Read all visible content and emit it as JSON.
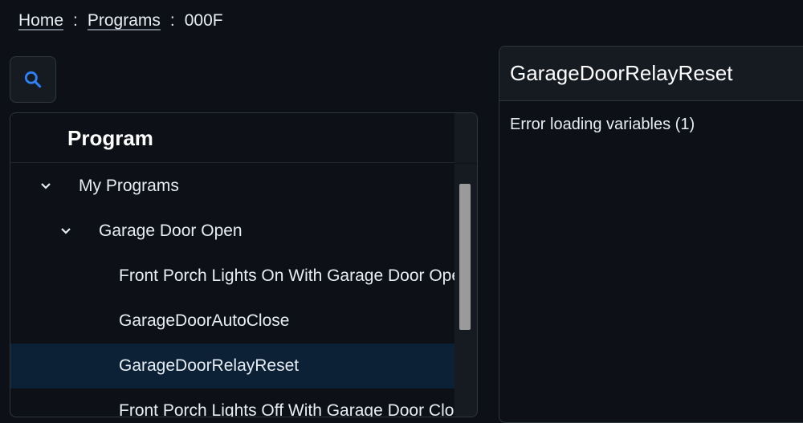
{
  "breadcrumb": {
    "home": "Home",
    "separator": ":",
    "programs": "Programs",
    "current": "000F"
  },
  "search": {
    "icon": "search-icon",
    "color": "#2f81f7"
  },
  "tree": {
    "header_title": "Program",
    "rows": [
      {
        "label": "My Programs",
        "expanded": true,
        "level": 0
      },
      {
        "label": "Garage Door Open",
        "expanded": true,
        "level": 1
      },
      {
        "label": "Front Porch Lights On With Garage Door Open",
        "level": 2
      },
      {
        "label": "GarageDoorAutoClose",
        "level": 2
      },
      {
        "label": "GarageDoorRelayReset",
        "level": 2,
        "selected": true
      },
      {
        "label": "Front Porch Lights Off With Garage Door Close",
        "level": 2
      }
    ]
  },
  "detail": {
    "title": "GarageDoorRelayReset",
    "message": "Error loading variables (1)"
  },
  "colors": {
    "background": "#0d1117",
    "panel": "#161b22",
    "selected_row": "#0c2136",
    "accent": "#2f81f7"
  }
}
